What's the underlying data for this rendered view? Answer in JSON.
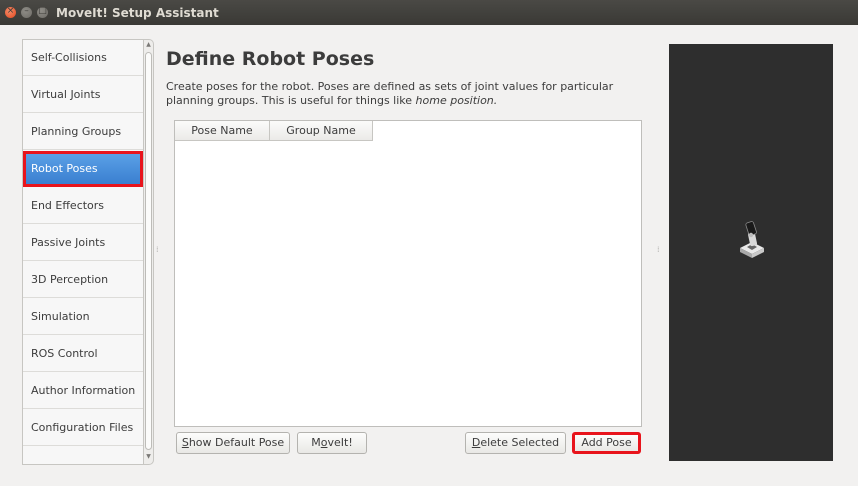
{
  "window": {
    "title": "MoveIt! Setup Assistant",
    "buttons": {
      "close_glyph": "×",
      "min_glyph": "–",
      "max_glyph": "□"
    }
  },
  "sidebar": {
    "items": [
      {
        "label": "Self-Collisions"
      },
      {
        "label": "Virtual Joints"
      },
      {
        "label": "Planning Groups"
      },
      {
        "label": "Robot Poses",
        "active": true
      },
      {
        "label": "End Effectors"
      },
      {
        "label": "Passive Joints"
      },
      {
        "label": "3D Perception"
      },
      {
        "label": "Simulation"
      },
      {
        "label": "ROS Control"
      },
      {
        "label": "Author Information"
      },
      {
        "label": "Configuration Files"
      }
    ],
    "scroll_up_glyph": "▲",
    "scroll_down_glyph": "▼"
  },
  "main": {
    "title": "Define Robot Poses",
    "description_line1": "Create poses for the robot. Poses are defined as sets of joint values for particular",
    "description_line2_prefix": "planning groups. This is useful for things like ",
    "description_line2_emphasis": "home position.",
    "table": {
      "columns": [
        "Pose Name",
        "Group Name"
      ],
      "rows": []
    },
    "buttons": {
      "show_default_pose": {
        "underline": "S",
        "rest": "how Default Pose"
      },
      "moveit": {
        "prefix": "M",
        "underline": "o",
        "rest": "veIt!"
      },
      "delete_selected": {
        "underline": "D",
        "rest": "elete Selected"
      },
      "add_pose": {
        "label": "Add Pose"
      }
    }
  },
  "viewport": {
    "background": "#2e2e2e"
  },
  "colors": {
    "highlight_box": "#e8141c",
    "active_nav": "#3a7fd0"
  }
}
